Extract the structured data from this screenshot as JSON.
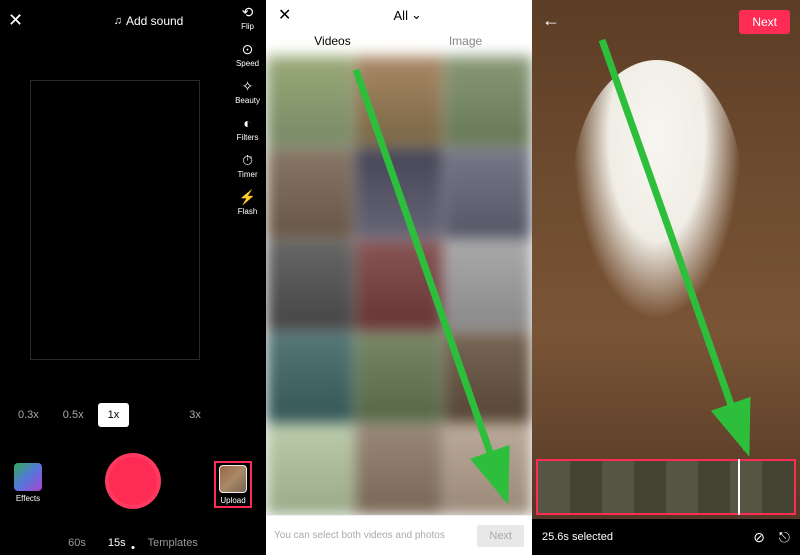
{
  "panel1": {
    "close": "✕",
    "add_sound": "Add sound",
    "tools": [
      {
        "name": "flip",
        "label": "Flip",
        "glyph": "⟲"
      },
      {
        "name": "speed",
        "label": "Speed",
        "glyph": "⊙"
      },
      {
        "name": "beauty",
        "label": "Beauty",
        "glyph": "✧"
      },
      {
        "name": "filters",
        "label": "Filters",
        "glyph": "◐"
      },
      {
        "name": "timer",
        "label": "Timer",
        "glyph": "⏱"
      },
      {
        "name": "flash",
        "label": "Flash",
        "glyph": "⚡"
      }
    ],
    "zoom": [
      "0.3x",
      "0.5x",
      "1x",
      "3x"
    ],
    "zoom_active": "1x",
    "effects_label": "Effects",
    "upload_label": "Upload",
    "modes": [
      "60s",
      "15s",
      "Templates"
    ],
    "mode_active": "15s"
  },
  "panel2": {
    "close": "✕",
    "all_label": "All",
    "tabs": [
      "Videos",
      "Image"
    ],
    "tab_active": "Videos",
    "hint": "You can select both videos and photos",
    "next": "Next"
  },
  "panel3": {
    "back": "←",
    "next": "Next",
    "selected": "25.6s selected",
    "speed_icon": "⊘",
    "rotate_icon": "⎋"
  }
}
